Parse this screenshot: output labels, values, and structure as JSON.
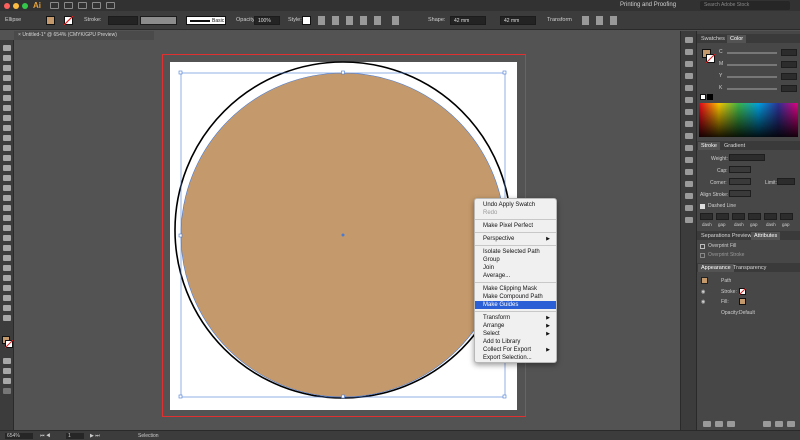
{
  "app": {
    "logo": "Ai",
    "workspace": "Printing and Proofing",
    "search_placeholder": "Search Adobe Stock"
  },
  "control_bar": {
    "selection_label": "Ellipse",
    "fill_color": "#c49a6c",
    "stroke_label": "Stroke:",
    "brush_label": "Basic",
    "opacity_label": "Opacity:",
    "opacity_value": "100%",
    "style_label": "Style:",
    "shape_label": "Shape:",
    "width_value": "42 mm",
    "height_value": "42 mm",
    "transform_label": "Transform"
  },
  "document": {
    "tab_title": "Untitled-1* @ 654% (CMYK/GPU Preview)"
  },
  "canvas": {
    "shape_fill": "#c49a6c"
  },
  "context_menu": {
    "items": [
      {
        "label": "Undo Apply Swatch"
      },
      {
        "label": "Redo",
        "disabled": true
      },
      {
        "label": "Make Pixel Perfect"
      },
      {
        "label": "Perspective",
        "submenu": true
      },
      {
        "label": "Isolate Selected Path"
      },
      {
        "label": "Group"
      },
      {
        "label": "Join"
      },
      {
        "label": "Average..."
      },
      {
        "label": "Make Clipping Mask"
      },
      {
        "label": "Make Compound Path"
      },
      {
        "label": "Make Guides",
        "highlighted": true
      },
      {
        "label": "Transform",
        "submenu": true
      },
      {
        "label": "Arrange",
        "submenu": true
      },
      {
        "label": "Select",
        "submenu": true
      },
      {
        "label": "Add to Library"
      },
      {
        "label": "Collect For Export",
        "submenu": true
      },
      {
        "label": "Export Selection..."
      }
    ]
  },
  "status_bar": {
    "zoom": "654%",
    "page": "1",
    "tool": "Selection"
  },
  "panels": {
    "color_tabs": [
      "Swatches",
      "Color"
    ],
    "cmyk_labels": [
      "C",
      "M",
      "Y",
      "K"
    ],
    "stroke_tabs": [
      "Stroke",
      "Gradient"
    ],
    "stroke_labels": {
      "weight": "Weight:",
      "cap": "Cap:",
      "corner": "Corner:",
      "limit": "Limit:",
      "align": "Align Stroke:",
      "dashed": "Dashed Line"
    },
    "dash_labels": [
      "dash",
      "gap",
      "dash",
      "gap",
      "dash",
      "gap"
    ],
    "sep_tabs": [
      "Separations Preview",
      "Attributes"
    ],
    "attributes": {
      "overprint_fill": "Overprint Fill",
      "overprint_stroke": "Overprint Stroke"
    },
    "appearance_tabs": [
      "Appearance",
      "Transparency"
    ],
    "appearance": {
      "path": "Path",
      "stroke": "Stroke:",
      "fill": "Fill:",
      "opacity": "Opacity:",
      "opacity_value": "Default"
    }
  }
}
